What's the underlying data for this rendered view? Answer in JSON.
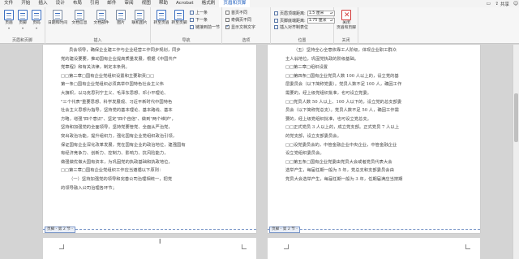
{
  "menu": {
    "tabs": [
      "文件",
      "开始",
      "插入",
      "设计",
      "布局",
      "引用",
      "邮件",
      "审阅",
      "视图",
      "帮助",
      "Acrobat",
      "格式刷",
      "页眉和页脚"
    ],
    "active_tab": "页眉和页脚",
    "share": "共享"
  },
  "ribbon": {
    "hf_group": {
      "label": "页眉和页脚",
      "header": "页眉",
      "footer": "页脚",
      "page_number": "页码"
    },
    "insert_group": {
      "label": "插入",
      "date_time": "日期和时间",
      "doc_info": "文档信息",
      "doc_parts": "文档部件",
      "pictures": "图片",
      "online_pictures": "联机图片"
    },
    "nav_group": {
      "label": "导航",
      "goto_header": "转至页眉",
      "goto_footer": "转至页脚",
      "previous": "上一条",
      "next": "下一条",
      "link_prev": "链接到前一节"
    },
    "options_group": {
      "label": "选项",
      "first_page": "首页不同",
      "odd_even": "奇偶页不同",
      "show_text": "显示文档文字"
    },
    "position_group": {
      "label": "位置",
      "header_top": "页眉顶端距离:",
      "header_top_value": "1.5 厘米",
      "footer_bottom": "页脚底端距离:",
      "footer_bottom_value": "1.75 厘米",
      "insert_align": "插入对齐制表位"
    },
    "close_group": {
      "label": "关闭",
      "close": "关闭\n页眉和页脚"
    }
  },
  "pages": {
    "left": {
      "lines": [
        "员会领导，确保企业建工作与企业经营工作同步规划，同步",
        "党的建设要要，推动国有企业提高质量发展，根据《中国共产",
        "党章程》和有关法律，制定本条例。",
        "□□第二章□国有企业党组织设置和主要职责□□",
        "第一条□国有企业党组织必须高举中国特色社会主义伟",
        "大旗帜，以马克思列宁主义、毛泽东思想、邓小平理论、",
        "\"三个代表\"重要思想、科学发展观、习近平新时代中国特色",
        "社会主义思想为指导，坚持党的基本理论、基本路线、基本",
        "方略，增强\"四个意识\"、坚定\"四个自信\"、做到\"两个维护\"，",
        "坚持和加强党的全面领导，坚持党要管党、全面从严治党，",
        "突出政治功能，提升组织力，强化国有企业党组织政治引领，",
        "保证国有企业深化改革发展，党在国有企业的政治地位，建强国有",
        "有经济竞争力、创新力、控制力、影响力、抗风险能力，",
        "做强做优做大国有资本，为巩固党的执政基础和执政地位，",
        "□□第三章□国有企业党组织工作应当遵循以下原则：",
        "（一）坚持加强党的领导和完善公司治理相统一，把党",
        "的领导融入公司治理各环节；"
      ],
      "footer": "页脚 - 第 2 节 -"
    },
    "right": {
      "lines": [
        "（五）坚持全心全意依靠工人阶级，体现企业职工群众",
        "主人翁地位，巩固党执政的阶级基础。",
        "□□第二章□组织设置",
        "□□第四条□国有企业党员人数 100 人以上的，设立党的基",
        "层委员会（以下简称党委）。党员人数不足 100 人，确因工作",
        "需要的，经上级党组织批准，也可设立党委。",
        "□□党员人数 50 人以上、100 人以下的，设立党的总支部委",
        "员会（以下简称党总支）。党员人数不足 50 人，确因工作需",
        "要的，经上级党组织批准，也可设立党总支。",
        "□□正式党员 3 人以上的，成立党支部。正式党员 7 人以上",
        "的党支部，设立支部委员会。",
        "□□设党委员会的，中管金融企业中央企业，中管金融企业",
        "设立党组织委员会。",
        "□□第五条□国有企业党委由党员大会或者党员代表大会",
        "选举产生，每届任期一般为 5 年，党总支和支部委员会由",
        "党员大会选举产生，每届任期一般为 3 年，任期届满应当按期"
      ],
      "footer": "页脚 - 第 2 节 -"
    }
  }
}
